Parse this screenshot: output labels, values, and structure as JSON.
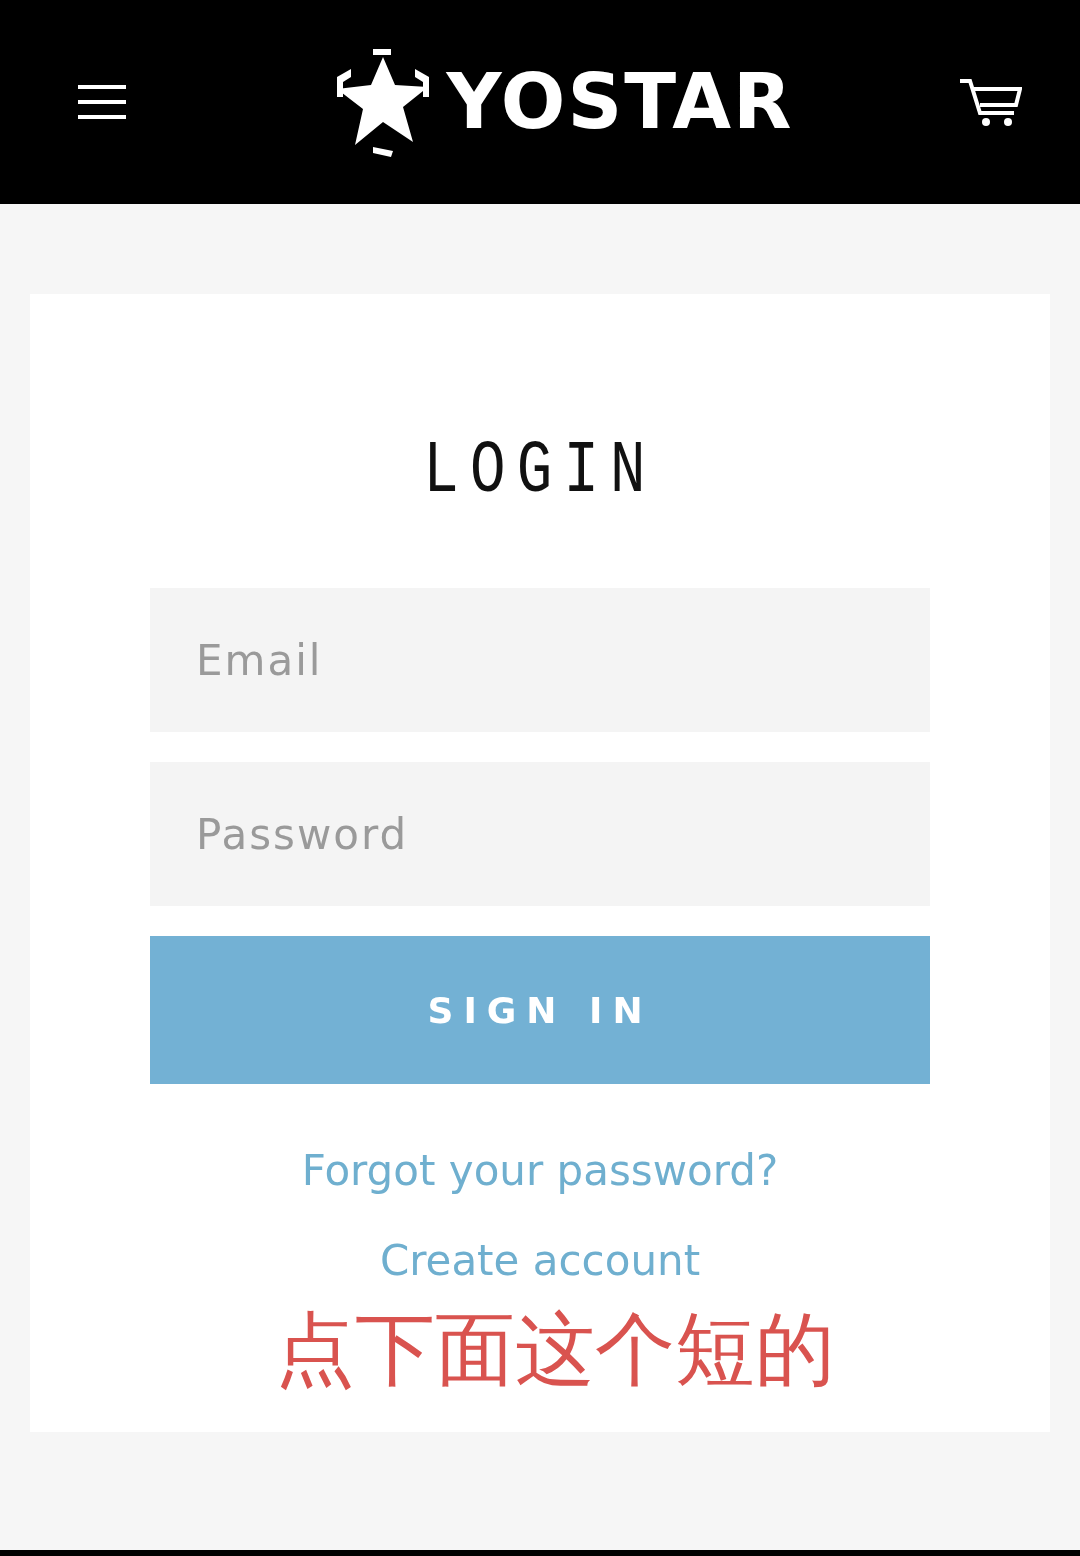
{
  "header": {
    "logo_text": "YOSTAR"
  },
  "login": {
    "title": "LOGIN",
    "email": {
      "placeholder": "Email"
    },
    "password": {
      "placeholder": "Password"
    },
    "submit": "SIGN IN",
    "links": [
      {
        "label": "Forgot your password?"
      },
      {
        "label": "Create account"
      }
    ]
  },
  "annotation": "点下面这个短的"
}
